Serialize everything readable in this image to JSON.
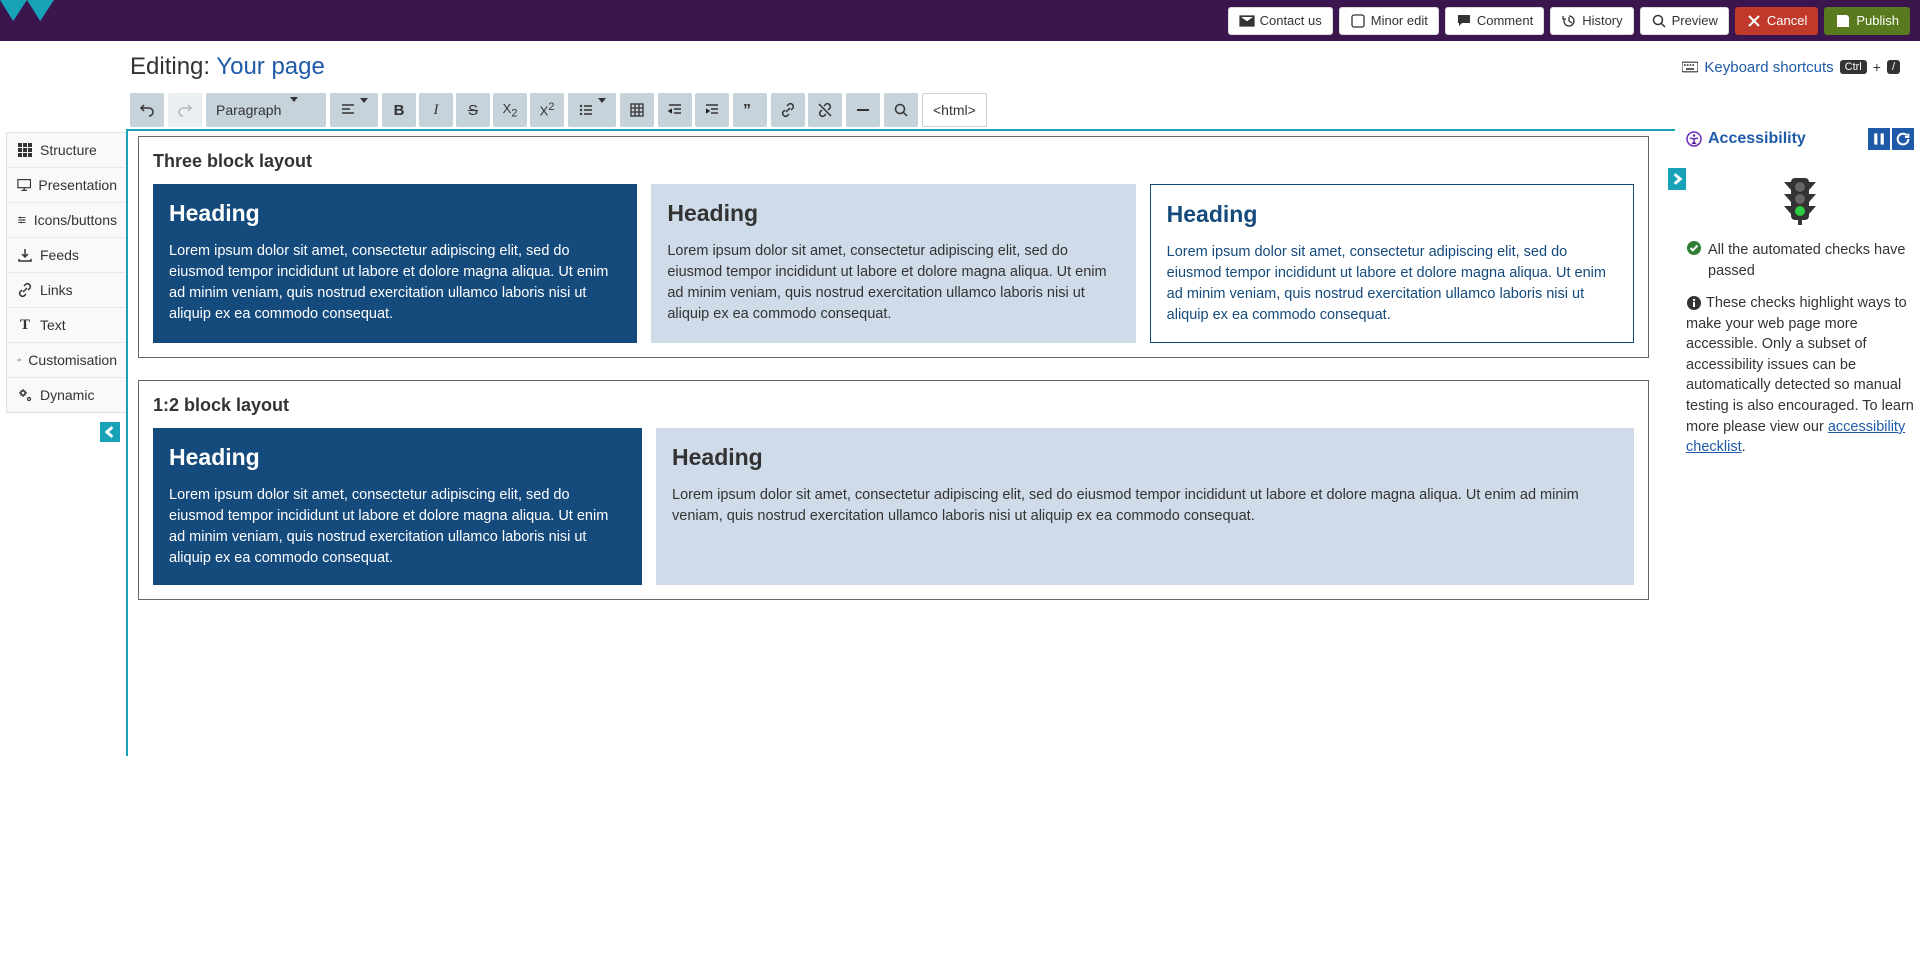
{
  "topbar": {
    "contact_us": "Contact us",
    "minor_edit": "Minor edit",
    "comment": "Comment",
    "history": "History",
    "preview": "Preview",
    "cancel": "Cancel",
    "publish": "Publish"
  },
  "page": {
    "editing_prefix": "Editing: ",
    "title": "Your page",
    "shortcuts_label": "Keyboard shortcuts",
    "shortcut_key1": "Ctrl",
    "shortcut_plus": "+",
    "shortcut_key2": "/"
  },
  "toolbar": {
    "paragraph": "Paragraph",
    "html_btn": "<html>"
  },
  "sidebar": {
    "items": [
      {
        "icon": "grid",
        "label": "Structure"
      },
      {
        "icon": "present",
        "label": "Presentation"
      },
      {
        "icon": "iconsbtn",
        "label": "Icons/buttons"
      },
      {
        "icon": "feed",
        "label": "Feeds"
      },
      {
        "icon": "link",
        "label": "Links"
      },
      {
        "icon": "text",
        "label": "Text"
      },
      {
        "icon": "code",
        "label": "Customisation"
      },
      {
        "icon": "gears",
        "label": "Dynamic"
      }
    ]
  },
  "content": {
    "layout1_title": "Three block layout",
    "layout2_title": "1:2 block layout",
    "heading": "Heading",
    "lorem": "Lorem ipsum dolor sit amet, consectetur adipiscing elit, sed do eiusmod tempor incididunt ut labore et dolore magna aliqua. Ut enim ad minim veniam, quis nostrud exercitation ullamco laboris nisi ut aliquip ex ea commodo consequat."
  },
  "accessibility": {
    "title": "Accessibility",
    "checks_passed": "All the automated checks have passed",
    "info_text": "These checks highlight ways to make your web page more accessible. Only a subset of accessibility issues can be automatically detected so manual testing is also encouraged. To learn more please view our ",
    "link_text": "accessibility checklist",
    "period": "."
  }
}
